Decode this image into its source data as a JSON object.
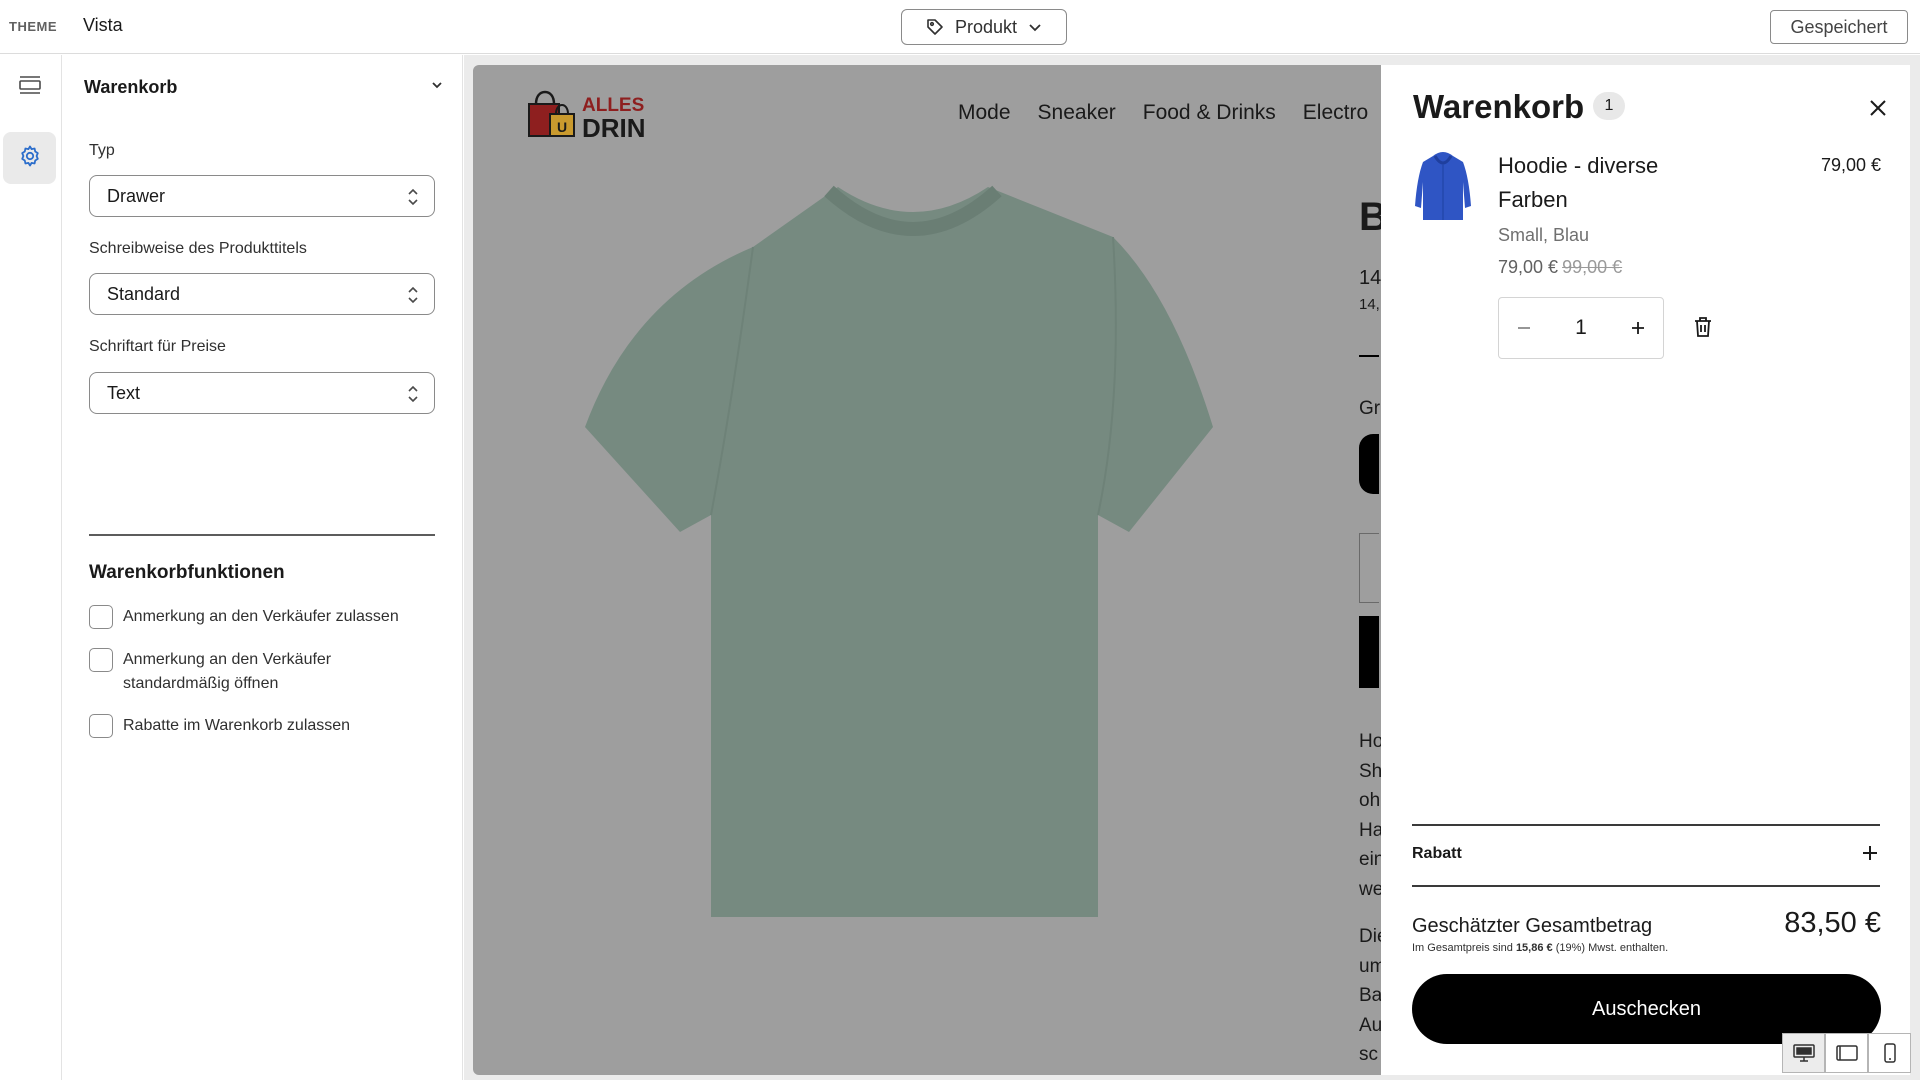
{
  "topbar": {
    "theme_label": "THEME",
    "theme_name": "Vista",
    "product_select": "Produkt",
    "saved_button": "Gespeichert"
  },
  "panel": {
    "title": "Warenkorb",
    "fields": [
      {
        "label": "Typ",
        "value": "Drawer"
      },
      {
        "label": "Schreibweise des Produkttitels",
        "value": "Standard"
      },
      {
        "label": "Schriftart für Preise",
        "value": "Text"
      }
    ],
    "section_title": "Warenkorbfunktionen",
    "checkboxes": [
      {
        "label": "Anmerkung an den Verkäufer zulassen",
        "checked": false
      },
      {
        "label": "Anmerkung an den Verkäufer standardmäßig öffnen",
        "checked": false
      },
      {
        "label": "Rabatte im Warenkorb zulassen",
        "checked": false
      }
    ]
  },
  "preview": {
    "logo_top": "ALLES",
    "logo_bottom": "DRIN",
    "logo_bag_letter": "U",
    "nav": [
      "Mode",
      "Sneaker",
      "Food & Drinks",
      "Electro"
    ],
    "peek": {
      "title": "B",
      "price": "14,",
      "price_small": "14,",
      "size_label": "Gr",
      "desc_1": [
        "Ho",
        "Sh",
        "oh",
        "Ha",
        "ein",
        "we"
      ],
      "desc_2": [
        "Die",
        "um",
        "Ba",
        "Au",
        "sc"
      ]
    }
  },
  "cart": {
    "title": "Warenkorb",
    "count": "1",
    "item": {
      "name": "Hoodie - diverse Farben",
      "price": "79,00 €",
      "variant": "Small, Blau",
      "sale_price": "79,00 €",
      "compare_price": "99,00 €",
      "quantity": "1"
    },
    "discount_label": "Rabatt",
    "total_label": "Geschätzter Gesamtbetrag",
    "total_value": "83,50 €",
    "tax_prefix": "Im Gesamtpreis sind",
    "tax_amount": "15,86 €",
    "tax_suffix": "(19%) Mwst. enthalten.",
    "checkout_label": "Auschecken"
  },
  "colors": {
    "overlay": "#9e9e9e",
    "tshirt": "#768a80",
    "hoodie": "#2f55c4",
    "accent_icon": "#2c6ecb"
  }
}
